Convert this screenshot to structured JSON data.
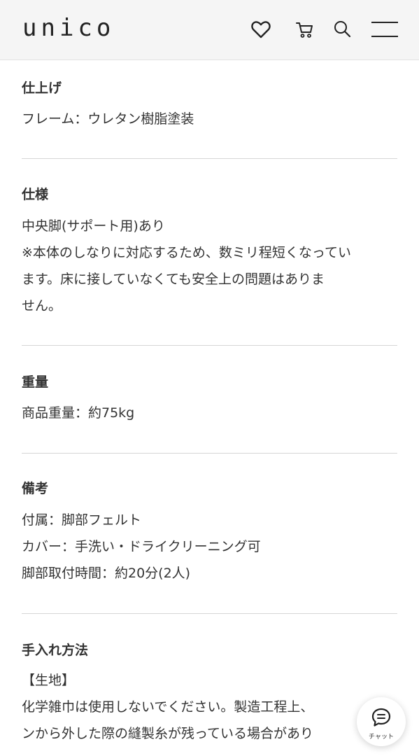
{
  "header": {
    "logo": "unico",
    "icons": [
      "heart-icon",
      "cart-icon",
      "search-icon",
      "menu-icon"
    ]
  },
  "sections": [
    {
      "title": "仕上げ",
      "lines": [
        "フレーム：ウレタン樹脂塗装"
      ]
    },
    {
      "title": "仕様",
      "lines": [
        "中央脚(サポート用)あり",
        "※本体のしなりに対応するため、数ミリ程短くなってい",
        "ます。床に接していなくても安全上の問題はありま",
        "せん。"
      ]
    },
    {
      "title": "重量",
      "lines": [
        "商品重量：約75kg"
      ]
    },
    {
      "title": "備考",
      "lines": [
        "付属：脚部フェルト",
        "カバー：手洗い・ドライクリーニング可",
        "脚部取付時間：約20分(2人)"
      ]
    },
    {
      "title": "手入れ方法",
      "lines": [
        "【生地】",
        "化学雑巾は使用しないでください。製造工程上、",
        "ンから外した際の縫製糸が残っている場合があり"
      ]
    }
  ],
  "chat": {
    "label": "チャット"
  },
  "colors": {
    "header_bg": "#f5f5f5",
    "text": "#333333",
    "divider": "#d6d6d6"
  }
}
